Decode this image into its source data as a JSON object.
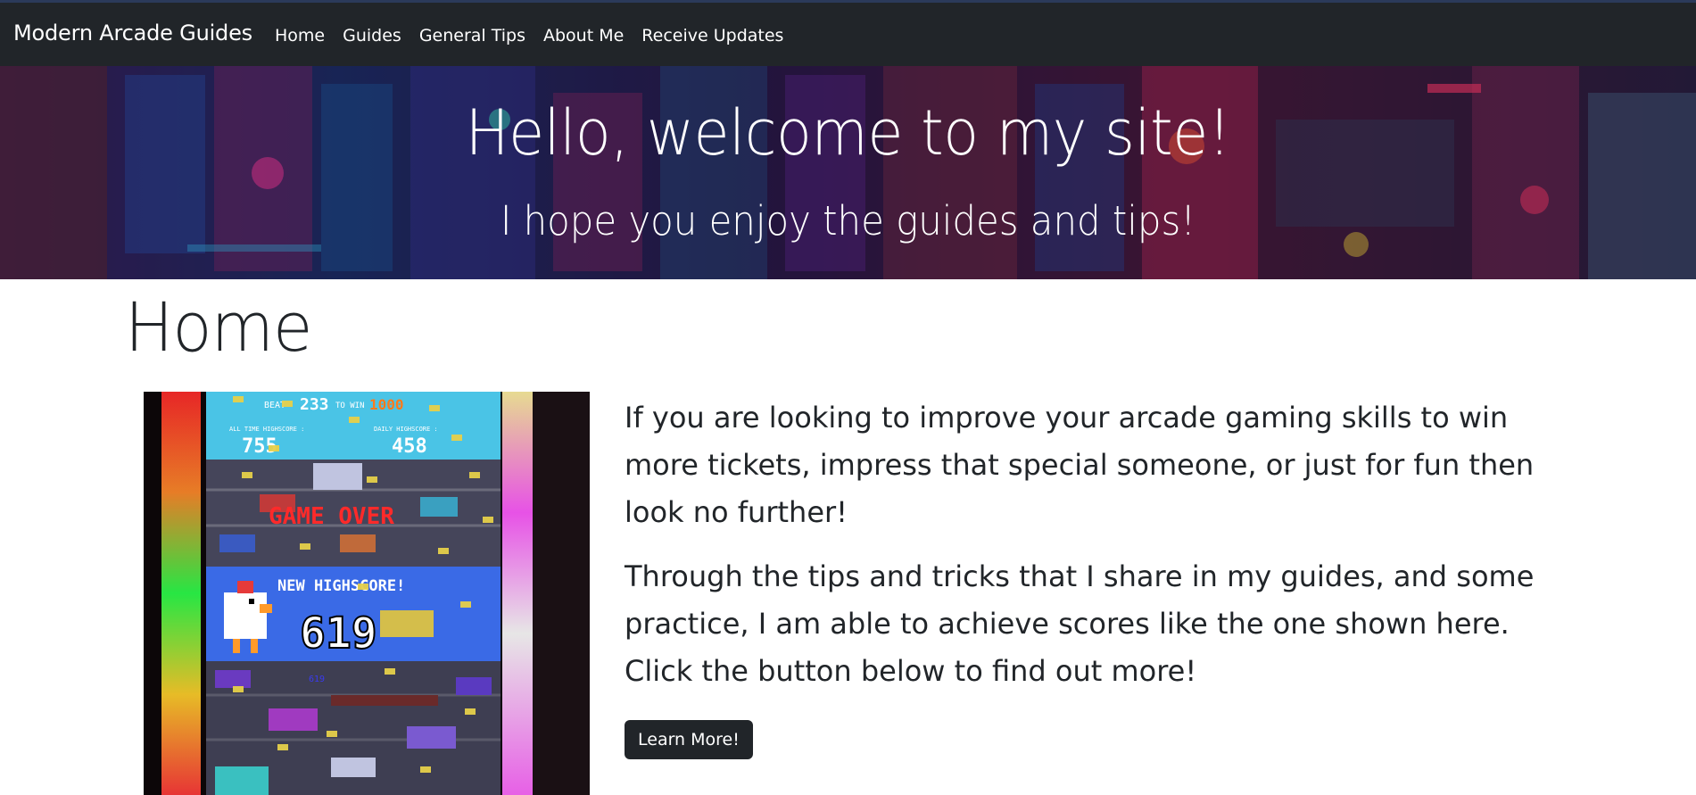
{
  "navbar": {
    "brand": "Modern Arcade Guides",
    "links": [
      "Home",
      "Guides",
      "General Tips",
      "About Me",
      "Receive Updates"
    ]
  },
  "hero": {
    "title": "Hello, welcome to my site!",
    "subtitle": "I hope you enjoy the guides and tips!"
  },
  "main": {
    "title": "Home",
    "paragraph1": "If you are looking to improve your arcade gaming skills to win more tickets, impress that special someone, or just for fun then look no further!",
    "paragraph2": "Through the tips and tricks that I share in my guides, and some practice, I am able to achieve scores like the one shown here. Click the button below to find out more!",
    "button_label": "Learn More!"
  },
  "photo": {
    "beat_text": "BEAT",
    "beat_value": "233",
    "to_win_text": "TO WIN",
    "to_win_value": "1000",
    "all_time_label": "ALL TIME HIGHSCORE :",
    "all_time_value": "755",
    "daily_label": "DAILY HIGHSCORE :",
    "daily_value": "458",
    "game_over_text": "GAME OVER",
    "new_highscore_text": "NEW HIGHSCORE!",
    "score_value": "619",
    "small_score_value": "619"
  },
  "colors": {
    "navbar": "#212529",
    "button": "#212529",
    "text": "#212529"
  }
}
